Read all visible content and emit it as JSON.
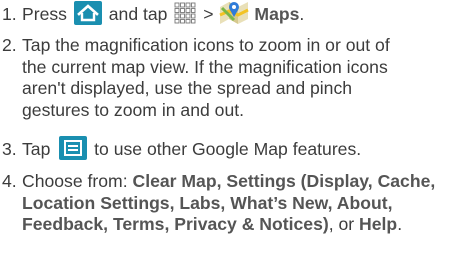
{
  "steps": [
    {
      "num": "1.",
      "t1": "Press ",
      "t2": " and tap ",
      "t3": " > ",
      "b1": "Maps",
      "t4": "."
    },
    {
      "num": "2.",
      "lines": [
        "Tap the magnification icons to zoom in or out of",
        "the current map view. If the magnification icons",
        "aren't displayed, use the spread and pinch",
        "gestures to zoom in and out."
      ]
    },
    {
      "num": "3.",
      "t1": "Tap ",
      "t2": " to use other Google Map features."
    },
    {
      "num": "4.",
      "t1": "Choose from: ",
      "b1": "Clear Map, Settings (Display, Cache,",
      "b2": "Location Settings, Labs, What’s New, About,",
      "b3": "Feedback, Terms, Privacy & Notices)",
      "t2": ", or ",
      "b4": "Help",
      "t3": "."
    }
  ],
  "icons": {
    "home": "home-icon",
    "apps": "apps-grid-icon",
    "maps": "maps-app-icon",
    "menu": "menu-icon",
    "accent": "#1a8fb0"
  }
}
